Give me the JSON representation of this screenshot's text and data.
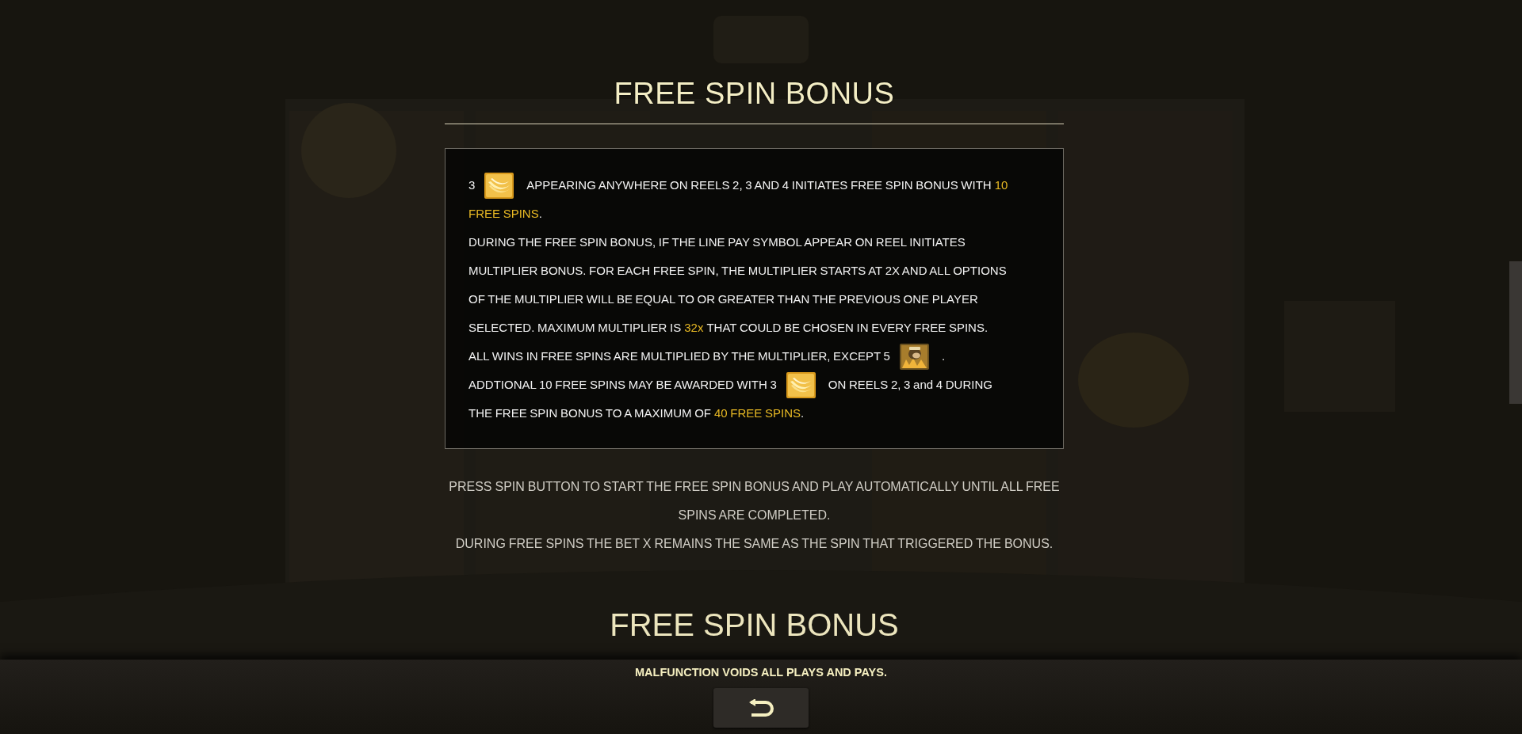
{
  "title": "FREE SPIN BONUS",
  "rules": [
    {
      "parts": [
        {
          "kind": "text",
          "text": "3",
          "highlight": false
        },
        {
          "kind": "scatter"
        },
        {
          "kind": "text",
          "text": "APPEARING ANYWHERE ON REELS 2, 3 AND 4 INITIATES FREE SPIN BONUS WITH",
          "highlight": false
        },
        {
          "kind": "text",
          "text": "10",
          "highlight": true
        }
      ]
    },
    {
      "parts": [
        {
          "kind": "text",
          "text": "FREE SPINS",
          "highlight": true
        },
        {
          "kind": "text",
          "text": ".",
          "highlight": false
        }
      ]
    },
    {
      "parts": [
        {
          "kind": "text",
          "text": "DURING THE FREE SPIN BONUS, IF THE LINE PAY SYMBOL APPEAR ON REEL INITIATES",
          "highlight": false
        }
      ]
    },
    {
      "parts": [
        {
          "kind": "text",
          "text": "MULTIPLIER BONUS. FOR EACH FREE SPIN, THE MULTIPLIER STARTS AT 2X AND ALL OPTIONS",
          "highlight": false
        }
      ]
    },
    {
      "parts": [
        {
          "kind": "text",
          "text": "OF THE MULTIPLIER WILL BE EQUAL TO OR GREATER THAN THE PREVIOUS ONE PLAYER",
          "highlight": false
        }
      ]
    },
    {
      "parts": [
        {
          "kind": "text",
          "text": "SELECTED. MAXIMUM MULTIPLIER IS",
          "highlight": false
        },
        {
          "kind": "text",
          "text": "32x",
          "highlight": true
        },
        {
          "kind": "text",
          "text": "THAT COULD BE CHOSEN IN EVERY FREE SPINS.",
          "highlight": false
        }
      ]
    },
    {
      "parts": [
        {
          "kind": "text",
          "text": "ALL WINS IN FREE SPINS ARE MULTIPLIED BY THE MULTIPLIER, EXCEPT 5",
          "highlight": false
        },
        {
          "kind": "wild"
        },
        {
          "kind": "text",
          "text": ".",
          "highlight": false
        }
      ]
    },
    {
      "parts": [
        {
          "kind": "text",
          "text": "ADDTIONAL 10 FREE SPINS MAY BE AWARDED WITH 3",
          "highlight": false
        },
        {
          "kind": "scatter"
        },
        {
          "kind": "text",
          "text": "ON REELS 2, 3 and 4 DURING",
          "highlight": false
        }
      ]
    },
    {
      "parts": [
        {
          "kind": "text",
          "text": "THE FREE SPIN BONUS TO A MAXIMUM OF",
          "highlight": false
        },
        {
          "kind": "text",
          "text": "40 FREE SPINS",
          "highlight": true
        },
        {
          "kind": "text",
          "text": ".",
          "highlight": false
        }
      ]
    }
  ],
  "notes": [
    "PRESS SPIN BUTTON TO START THE FREE SPIN BONUS AND PLAY AUTOMATICALLY UNTIL ALL FREE",
    "SPINS ARE COMPLETED.",
    "DURING FREE SPINS THE BET X REMAINS THE SAME AS THE SPIN THAT TRIGGERED THE BONUS."
  ],
  "next_title": "FREE SPIN BONUS",
  "footer": {
    "disclaimer": "MALFUNCTION VOIDS ALL PLAYS AND PAYS."
  }
}
